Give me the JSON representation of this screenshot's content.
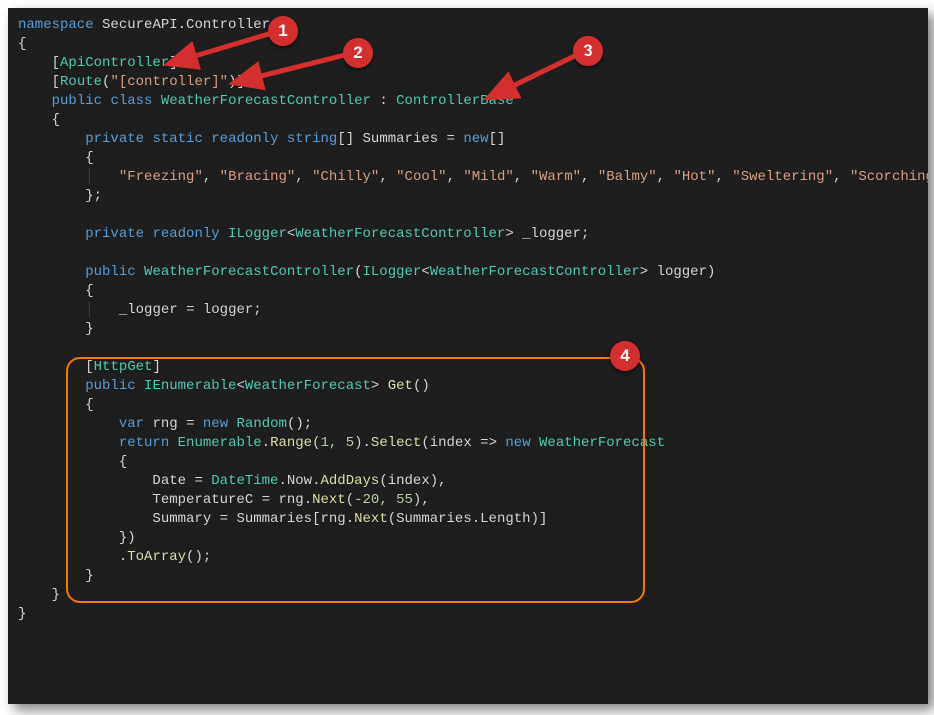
{
  "code": {
    "namespace_kw": "namespace",
    "namespace_name": "SecureAPI.Controllers",
    "attr_api": "ApiController",
    "attr_route_name": "Route",
    "attr_route_arg": "\"[controller]\"",
    "public_kw": "public",
    "class_kw": "class",
    "class_name": "WeatherForecastController",
    "base_class": "ControllerBase",
    "private_kw": "private",
    "static_kw": "static",
    "readonly_kw": "readonly",
    "string_type": "string",
    "summaries_field": "Summaries",
    "new_kw": "new",
    "summary_vals": [
      "\"Freezing\"",
      "\"Bracing\"",
      "\"Chilly\"",
      "\"Cool\"",
      "\"Mild\"",
      "\"Warm\"",
      "\"Balmy\"",
      "\"Hot\"",
      "\"Sweltering\"",
      "\"Scorching\""
    ],
    "ilogger_type": "ILogger",
    "logger_field": "_logger",
    "ctor_param": "logger",
    "httpget_attr": "HttpGet",
    "ienum_type": "IEnumerable",
    "wf_type": "WeatherForecast",
    "get_method": "Get",
    "var_kw": "var",
    "rng_var": "rng",
    "random_type": "Random",
    "return_kw": "return",
    "enumerable_type": "Enumerable",
    "range_method": "Range",
    "range_args": "1, 5",
    "select_method": "Select",
    "index_var": "index",
    "date_prop": "Date",
    "datetime_type": "DateTime",
    "now_prop": "Now",
    "adddays_method": "AddDays",
    "tempc_prop": "TemperatureC",
    "next_method": "Next",
    "next_args1": "-20, 55",
    "summary_prop": "Summary",
    "length_prop": "Length",
    "toarray_method": "ToArray"
  },
  "callouts": {
    "1": "1",
    "2": "2",
    "3": "3",
    "4": "4"
  }
}
